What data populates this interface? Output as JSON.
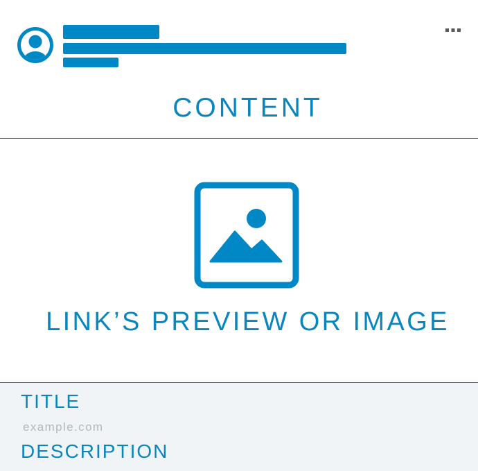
{
  "colors": {
    "accent": "#0087c5",
    "text_accent": "#0a86bf",
    "footer_bg": "#f0f4f7",
    "muted": "#b4b8bc"
  },
  "header": {
    "avatar_icon": "user-avatar-icon",
    "more_icon": "more-horizontal-icon"
  },
  "post": {
    "content_label": "CONTENT"
  },
  "preview": {
    "image_icon": "image-placeholder-icon",
    "label": "LINK’S PREVIEW OR IMAGE"
  },
  "link": {
    "title": "TITLE",
    "domain": "example.com",
    "description": "DESCRIPTION"
  }
}
